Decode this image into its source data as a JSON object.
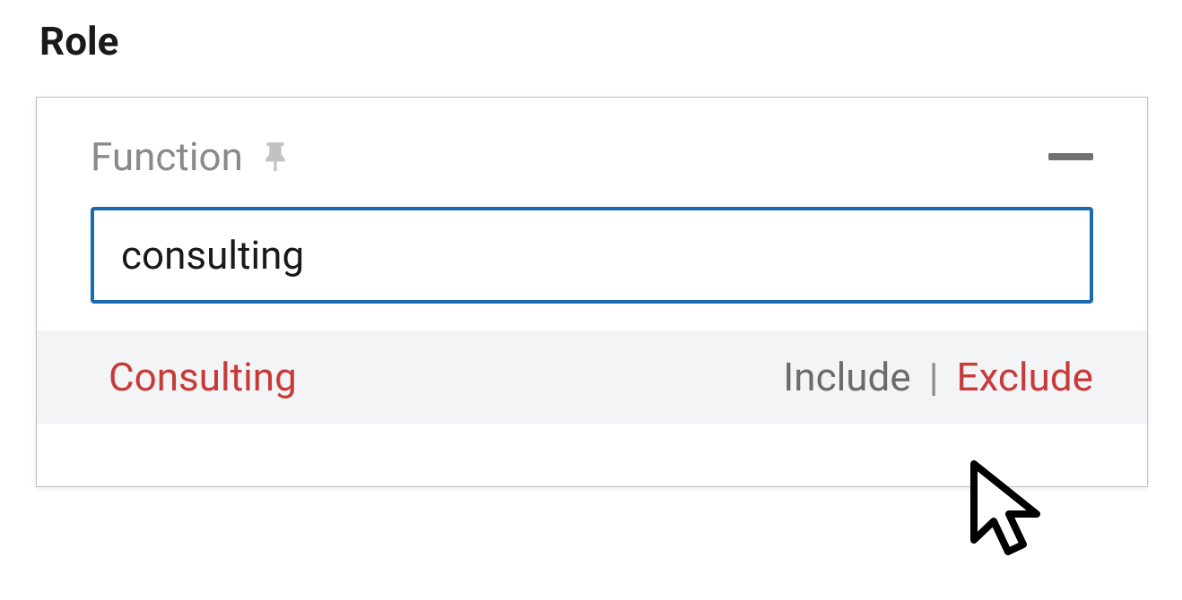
{
  "section": {
    "title": "Role"
  },
  "filter": {
    "label": "Function",
    "input_value": "consulting"
  },
  "suggestion": {
    "text": "Consulting",
    "include_label": "Include",
    "separator": "|",
    "exclude_label": "Exclude"
  },
  "icons": {
    "pin": "pin-icon",
    "collapse": "minus-icon",
    "cursor": "cursor-icon"
  }
}
